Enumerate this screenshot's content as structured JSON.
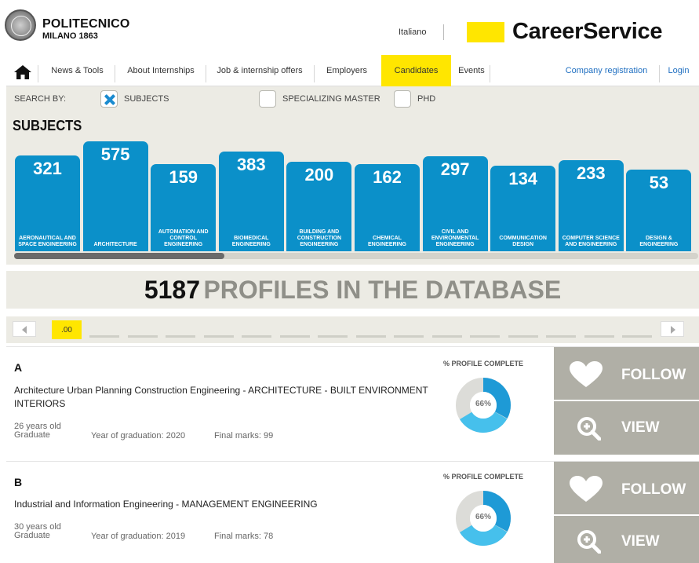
{
  "header": {
    "logo_name": "POLITECNICO",
    "logo_sub": "MILANO 1863",
    "lang": "Italiano",
    "brand": "CareerService"
  },
  "nav": {
    "items": [
      "News & Tools",
      "About Internships",
      "Job & internship offers",
      "Employers",
      "Candidates",
      "Events"
    ],
    "active": "Candidates",
    "right": [
      "Company registration",
      "Login"
    ]
  },
  "search": {
    "label": "SEARCH BY:",
    "options": [
      {
        "label": "SUBJECTS",
        "checked": true
      },
      {
        "label": "SPECIALIZING MASTER",
        "checked": false
      },
      {
        "label": "PHD",
        "checked": false
      }
    ]
  },
  "subjects": {
    "title": "SUBJECTS",
    "items": [
      {
        "value": "321",
        "label": "AERONAUTICAL AND SPACE ENGINEERING"
      },
      {
        "value": "575",
        "label": "ARCHITECTURE"
      },
      {
        "value": "159",
        "label": "AUTOMATION AND CONTROL ENGINEERING"
      },
      {
        "value": "383",
        "label": "BIOMEDICAL ENGINEERING"
      },
      {
        "value": "200",
        "label": "BUILDING AND CONSTRUCTION ENGINEERING"
      },
      {
        "value": "162",
        "label": "CHEMICAL ENGINEERING"
      },
      {
        "value": "297",
        "label": "CIVIL AND ENVIRONMENTAL ENGINEERING"
      },
      {
        "value": "134",
        "label": "COMMUNICATION DESIGN"
      },
      {
        "value": "233",
        "label": "COMPUTER SCIENCE AND ENGINEERING"
      },
      {
        "value": "53",
        "label": "DESIGN & ENGINEERING"
      }
    ]
  },
  "banner": {
    "count": "5187",
    "text": "PROFILES IN THE DATABASE"
  },
  "pager": {
    "current": ".00"
  },
  "profiles": [
    {
      "name": "A",
      "description": "Architecture Urban Planning Construction Engineering - ARCHITECTURE - BUILT ENVIRONMENT INTERIORS",
      "age": "26 years old",
      "status": "Graduate",
      "graduation": "Year of graduation: 2020",
      "marks": "Final marks: 99",
      "pc_title": "% PROFILE COMPLETE",
      "pc_value": "66%",
      "follow": "FOLLOW",
      "view": "VIEW"
    },
    {
      "name": "B",
      "description": "Industrial and Information Engineering - MANAGEMENT ENGINEERING",
      "age": "30 years old",
      "status": "Graduate",
      "graduation": "Year of graduation: 2019",
      "marks": "Final marks: 78",
      "pc_title": "% PROFILE COMPLETE",
      "pc_value": "66%",
      "follow": "FOLLOW",
      "view": "VIEW"
    }
  ],
  "colors": {
    "accent_yellow": "#ffe600",
    "bar_blue": "#0b90c9",
    "panel_beige": "#ecebe4",
    "action_grey": "#b0afa6"
  }
}
